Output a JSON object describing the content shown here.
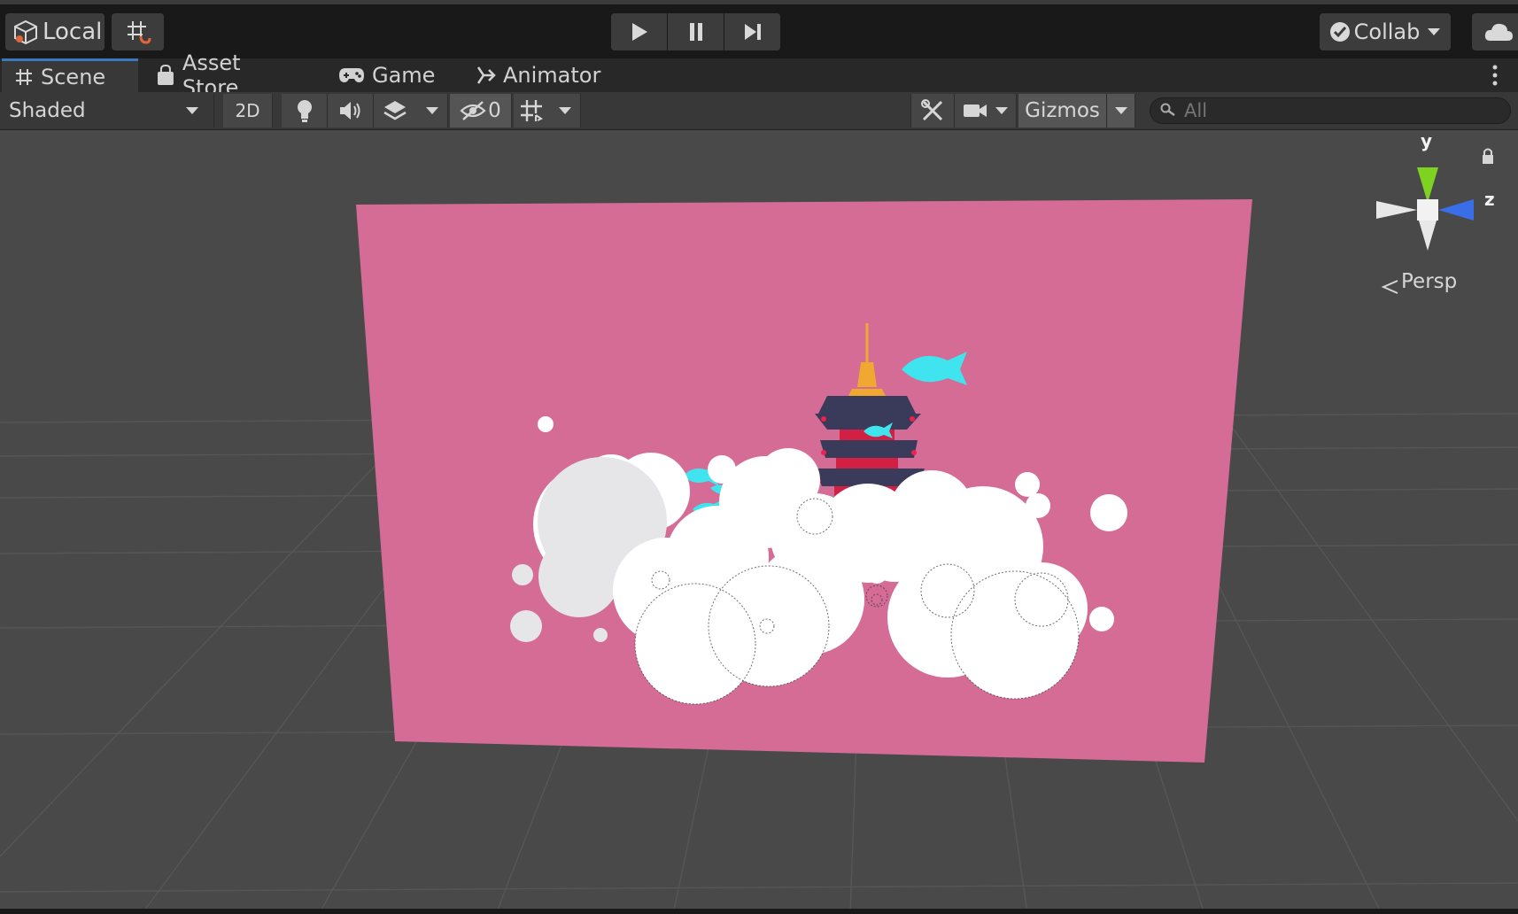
{
  "topbar": {
    "pivot_label": "Local",
    "collab_label": "Collab"
  },
  "tabs": [
    {
      "label": "Scene",
      "active": true
    },
    {
      "label": "Asset Store",
      "active": false
    },
    {
      "label": "Game",
      "active": false
    },
    {
      "label": "Animator",
      "active": false
    }
  ],
  "scene_toolbar": {
    "draw_mode": "Shaded",
    "mode_2d": "2D",
    "hidden_count": "0",
    "gizmos_label": "Gizmos",
    "search_placeholder": "All"
  },
  "orientation_gizmo": {
    "y_label": "y",
    "z_label": "z",
    "projection_label": "Persp"
  },
  "colors": {
    "accent": "#3a79bb",
    "background_plane": "#d46c96",
    "fish": "#3fe4ef",
    "pagoda_roof": "#3a3a5a",
    "pagoda_spire": "#f0a830",
    "axis_y": "#7ed321",
    "axis_z": "#3a6ee8"
  }
}
